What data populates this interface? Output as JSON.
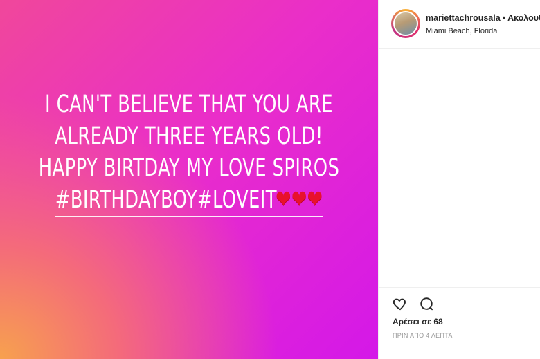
{
  "post": {
    "story_lines": [
      "I CAN'T BELIEVE THAT YOU ARE",
      "ALREADY THREE YEARS OLD!",
      "HAPPY BIRTDAY MY LOVE SPIROS"
    ],
    "hashtags": "#BIRTHDAYBOY#LOVEIT",
    "hearts": "❤❤❤"
  },
  "header": {
    "username": "mariettachrousala",
    "separator": "•",
    "follow_label": "Ακολουθ",
    "location": "Miami Beach, Florida"
  },
  "actions": {
    "likes_text": "Αρέσει σε 68",
    "time_text": "ΠΡΙΝ ΑΠΟ 4 ΛΕΠΤΑ"
  },
  "colors": {
    "gradient_pink": "#ea2ec9",
    "gradient_orange": "#f7a14e",
    "heart_red": "#e8112d"
  },
  "icons": [
    "heart-icon",
    "comment-icon"
  ]
}
